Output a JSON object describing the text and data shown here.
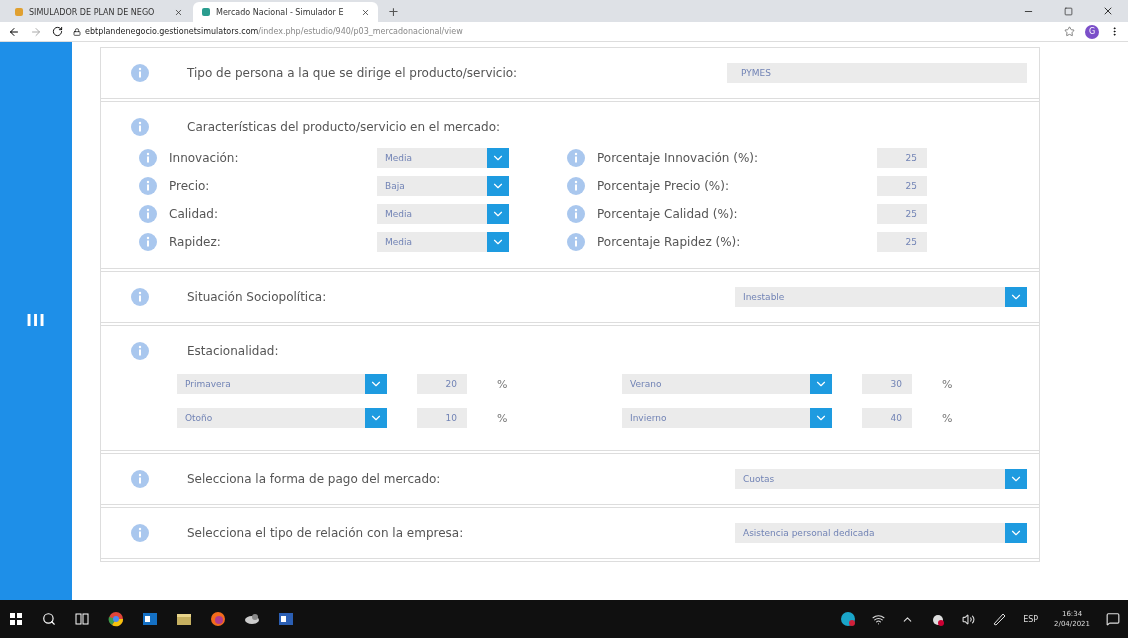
{
  "browser": {
    "tabs": [
      {
        "title": "SIMULADOR DE PLAN DE NEGO",
        "selected": false
      },
      {
        "title": "Mercado Nacional - Simulador E",
        "selected": true
      }
    ],
    "new_tab": "+",
    "url_host": "ebtplandenegocio.gestionetsimulators.com",
    "url_path": "/index.php/estudio/940/p03_mercadonacional/view",
    "profile": "G"
  },
  "sidebar": {
    "toggle": "III"
  },
  "sections": [
    {
      "kind": "field",
      "label": "Tipo de persona a la que se dirige el producto/servicio:",
      "value": "PYMES"
    },
    {
      "kind": "characteristics",
      "title": "Características del producto/servicio en el mercado:",
      "items": [
        {
          "label": "Innovación:",
          "value": "Media",
          "pct_label": "Porcentaje Innovación (%):",
          "pct": "25"
        },
        {
          "label": "Precio:",
          "value": "Baja",
          "pct_label": "Porcentaje Precio (%):",
          "pct": "25"
        },
        {
          "label": "Calidad:",
          "value": "Media",
          "pct_label": "Porcentaje Calidad (%):",
          "pct": "25"
        },
        {
          "label": "Rapidez:",
          "value": "Media",
          "pct_label": "Porcentaje Rapidez (%):",
          "pct": "25"
        }
      ]
    },
    {
      "kind": "select",
      "label": "Situación Sociopolítica:",
      "value": "Inestable"
    },
    {
      "kind": "seasonality",
      "title": "Estacionalidad:",
      "items": [
        {
          "season": "Primavera",
          "pct": "20",
          "unit": "%"
        },
        {
          "season": "Verano",
          "pct": "30",
          "unit": "%"
        },
        {
          "season": "Otoño",
          "pct": "10",
          "unit": "%"
        },
        {
          "season": "Invierno",
          "pct": "40",
          "unit": "%"
        }
      ]
    },
    {
      "kind": "select",
      "label": "Selecciona la forma de pago del mercado:",
      "value": "Cuotas"
    },
    {
      "kind": "select",
      "label": "Selecciona el tipo de relación con la empresa:",
      "value": "Asistencia personal dedicada"
    }
  ],
  "taskbar": {
    "language": "ESP",
    "time": "16:34",
    "date": "2/04/2021"
  }
}
